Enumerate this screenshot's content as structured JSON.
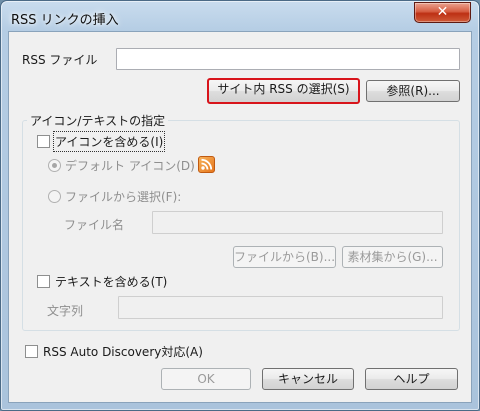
{
  "window": {
    "title": "RSS リンクの挿入",
    "close_glyph": "✕"
  },
  "rss_file": {
    "label": "RSS ファイル",
    "value": "",
    "site_rss_button": "サイト内 RSS の選択(S)",
    "browse_button": "参照(R)..."
  },
  "icon_text_group": {
    "title": "アイコン/テキストの指定",
    "include_icon_label": "アイコンを含める(I)",
    "default_icon_label": "デフォルト アイコン(D)",
    "from_file_label": "ファイルから選択(F):",
    "filename_label": "ファイル名",
    "filename_value": "",
    "from_file_button": "ファイルから(B)...",
    "from_assets_button": "素材集から(G)...",
    "include_text_label": "テキストを含める(T)",
    "text_label": "文字列",
    "text_value": ""
  },
  "auto_discovery_label": "RSS Auto Discovery対応(A)",
  "footer": {
    "ok": "OK",
    "cancel": "キャンセル",
    "help": "ヘルプ"
  },
  "colors": {
    "rss_icon": "#e6761c",
    "highlight_border": "#d8141b"
  }
}
